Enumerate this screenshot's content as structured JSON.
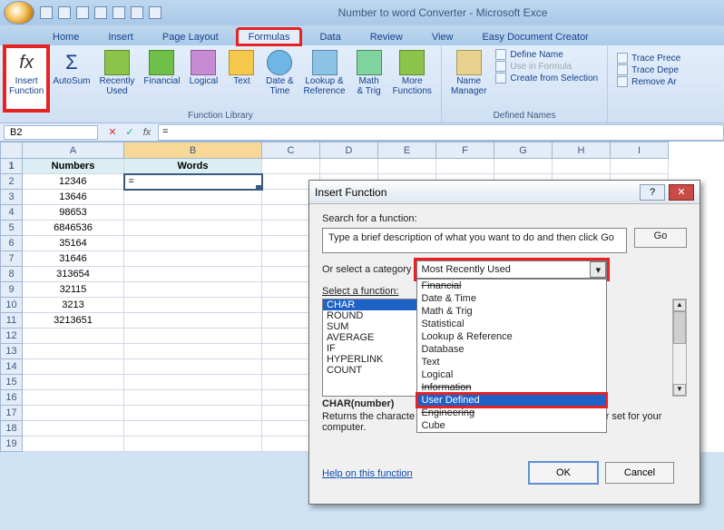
{
  "window": {
    "title": "Number to word Converter - Microsoft Exce"
  },
  "tabs": [
    "Home",
    "Insert",
    "Page Layout",
    "Formulas",
    "Data",
    "Review",
    "View",
    "Easy Document Creator"
  ],
  "active_tab_index": 3,
  "ribbon": {
    "insert_function": "Insert\nFunction",
    "autosum": "AutoSum",
    "recently_used": "Recently\nUsed",
    "financial": "Financial",
    "logical": "Logical",
    "text": "Text",
    "date_time": "Date &\nTime",
    "lookup": "Lookup &\nReference",
    "math": "Math\n& Trig",
    "more": "More\nFunctions",
    "group_library": "Function Library",
    "name_manager": "Name\nManager",
    "define_name": "Define Name",
    "use_in_formula": "Use in Formula",
    "create_selection": "Create from Selection",
    "group_names": "Defined Names",
    "trace_prec": "Trace Prece",
    "trace_dep": "Trace Depe",
    "remove_ar": "Remove Ar"
  },
  "cellref": "B2",
  "formula_value": "=",
  "columns": [
    "A",
    "B",
    "C",
    "D",
    "E",
    "F",
    "G",
    "H",
    "I"
  ],
  "headers": {
    "A": "Numbers",
    "B": "Words"
  },
  "rows": [
    {
      "n": "12346",
      "w": "="
    },
    {
      "n": "13646",
      "w": ""
    },
    {
      "n": "98653",
      "w": ""
    },
    {
      "n": "6846536",
      "w": ""
    },
    {
      "n": "35164",
      "w": ""
    },
    {
      "n": "31646",
      "w": ""
    },
    {
      "n": "313654",
      "w": ""
    },
    {
      "n": "32115",
      "w": ""
    },
    {
      "n": "3213",
      "w": ""
    },
    {
      "n": "3213651",
      "w": ""
    }
  ],
  "dialog": {
    "title": "Insert Function",
    "search_label": "Search for a function:",
    "search_placeholder": "Type a brief description of what you want to do and then click Go",
    "go": "Go",
    "cat_label": "Or select a category",
    "cat_value": "Most Recently Used",
    "cat_options": [
      "Financial",
      "Date & Time",
      "Math & Trig",
      "Statistical",
      "Lookup & Reference",
      "Database",
      "Text",
      "Logical",
      "Information",
      "User Defined",
      "Engineering",
      "Cube"
    ],
    "cat_highlight_index": 9,
    "select_fn_label": "Select a function:",
    "functions": [
      "CHAR",
      "ROUND",
      "SUM",
      "AVERAGE",
      "IF",
      "HYPERLINK",
      "COUNT"
    ],
    "fn_selected_index": 0,
    "signature": "CHAR(number)",
    "description_pre": "Returns the characte",
    "description_post": "racter set for your computer.",
    "help_link": "Help on this function",
    "ok": "OK",
    "cancel": "Cancel"
  }
}
